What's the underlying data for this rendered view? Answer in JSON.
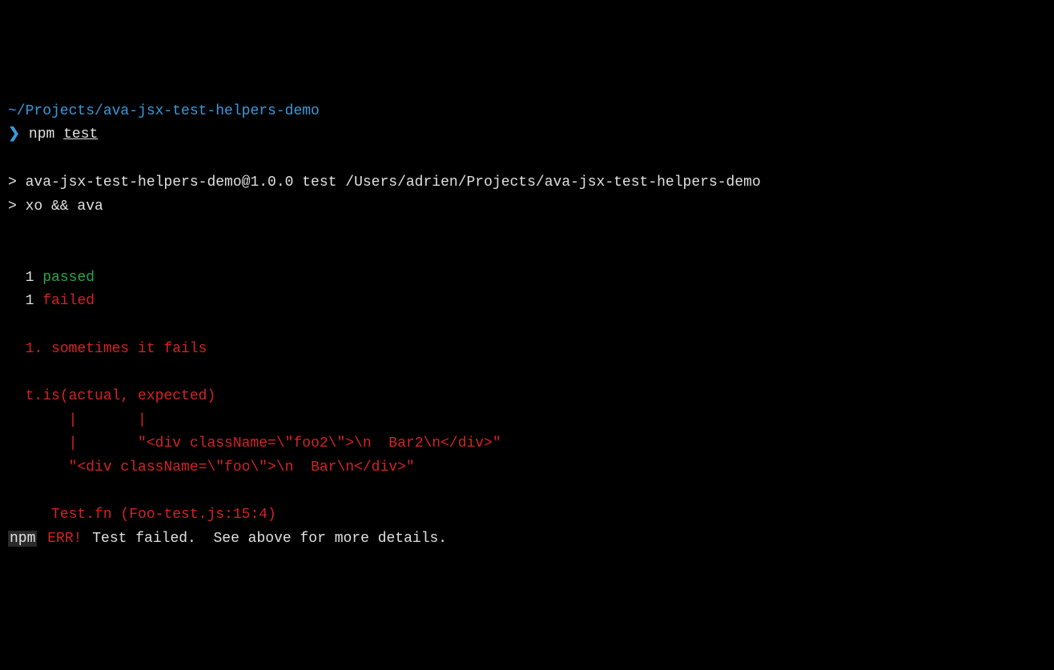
{
  "cwd": "~/Projects/ava-jsx-test-helpers-demo",
  "prompt": "❯",
  "command": {
    "name": "npm",
    "arg": "test"
  },
  "scriptHeader": {
    "line1": "> ava-jsx-test-helpers-demo@1.0.0 test /Users/adrien/Projects/ava-jsx-test-helpers-demo",
    "line2": "> xo && ava"
  },
  "results": {
    "passedCount": "1",
    "passedLabel": "passed",
    "failedCount": "1",
    "failedLabel": "failed"
  },
  "failure": {
    "title": "1. sometimes it fails",
    "assertion": "t.is(actual, expected)",
    "pointer1": "     |       |",
    "pointer2": "     |       \"<div className=\\\"foo2\\\">\\n  Bar2\\n</div>\"",
    "pointer3": "     \"<div className=\\\"foo\\\">\\n  Bar\\n</div>\"",
    "location": "Test.fn (Foo-test.js:15:4)"
  },
  "npmError": {
    "npm": "npm",
    "err": "ERR!",
    "message": " Test failed.  See above for more details."
  }
}
